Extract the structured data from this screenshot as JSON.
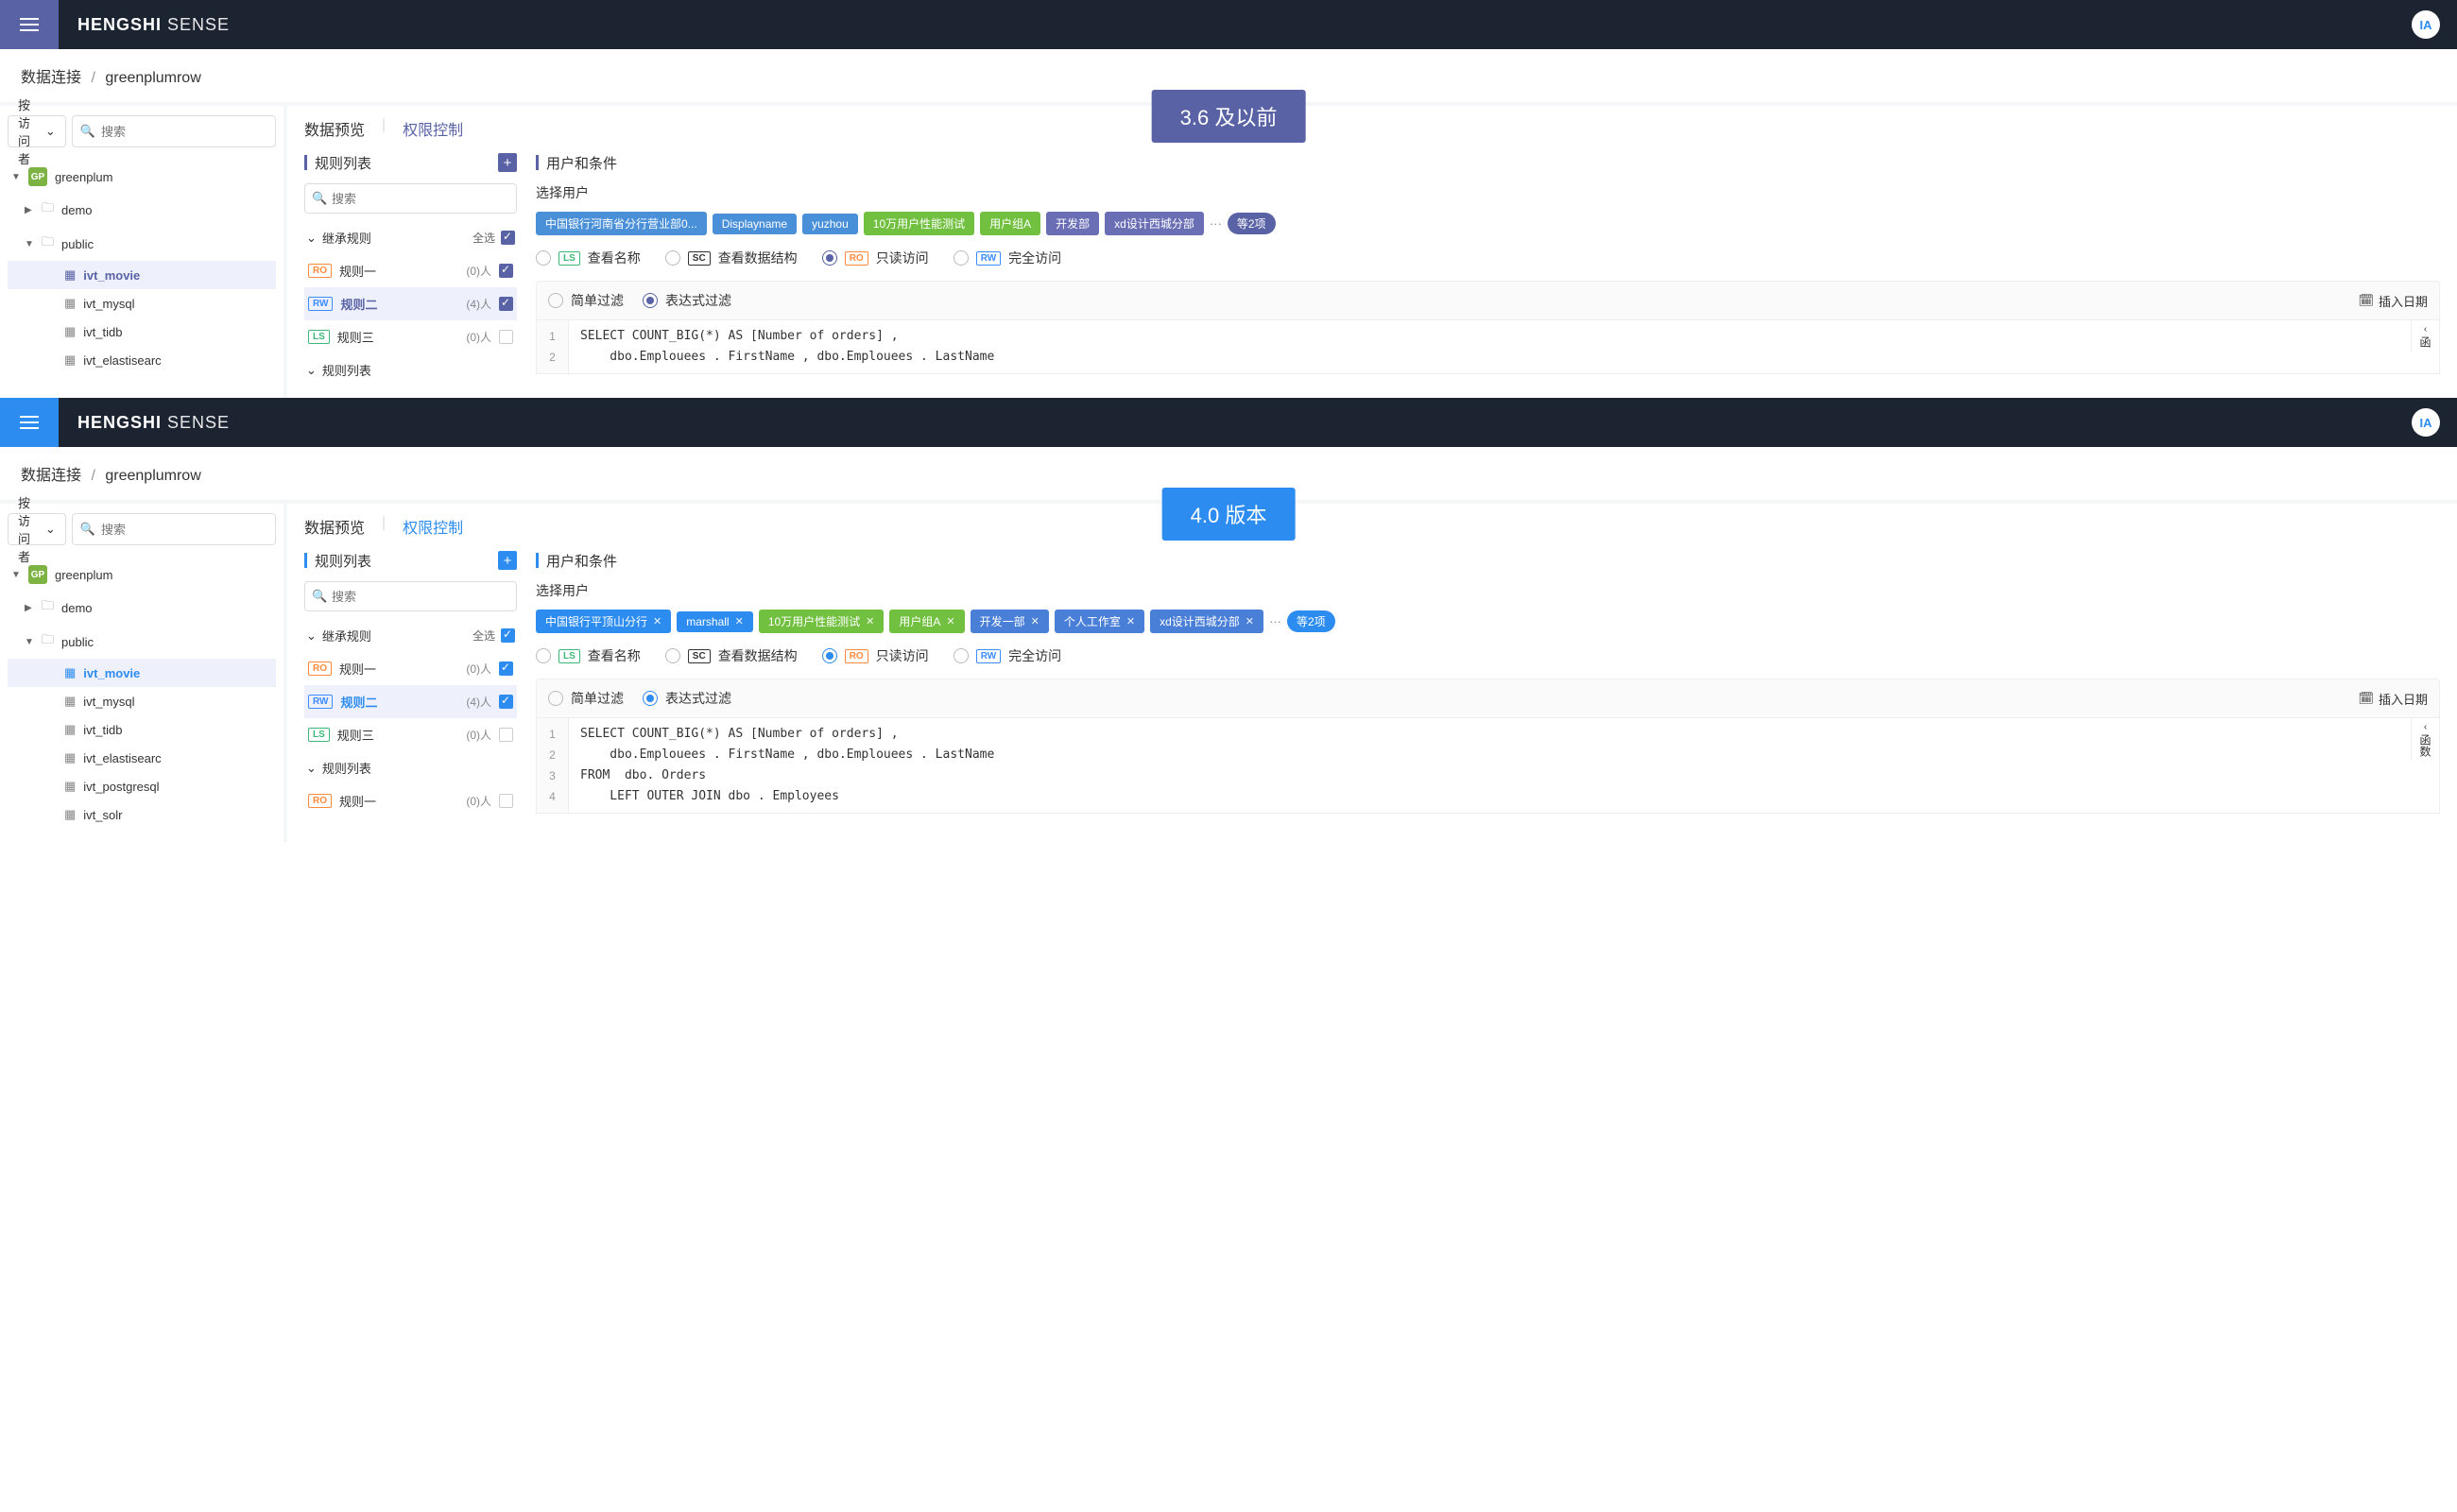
{
  "brand": {
    "bold": "HENGSHI",
    "light": "SENSE",
    "avatar": "IA"
  },
  "badges": {
    "v36": "3.6 及以前",
    "v40": "4.0 版本"
  },
  "breadcrumb": {
    "a": "数据连接",
    "b": "greenplumrow"
  },
  "sidebar": {
    "visitor_label": "按访问者",
    "search_ph": "搜索",
    "root": {
      "label": "greenplum",
      "badge": "GP"
    },
    "folders": [
      {
        "label": "demo",
        "expanded": false
      },
      {
        "label": "public",
        "expanded": true
      }
    ],
    "tables_v36": [
      "ivt_movie",
      "ivt_mysql",
      "ivt_tidb",
      "ivt_elastisearc"
    ],
    "tables_v40": [
      "ivt_movie",
      "ivt_mysql",
      "ivt_tidb",
      "ivt_elastisearc",
      "ivt_postgresql",
      "ivt_solr"
    ],
    "selected": "ivt_movie"
  },
  "tabs": {
    "preview": "数据预览",
    "perm": "权限控制"
  },
  "rules": {
    "title": "规则列表",
    "search_ph": "搜索",
    "group1_label": "继承规则",
    "select_all": "全选",
    "group2_label": "规则列表",
    "items": [
      {
        "perm": "RO",
        "name": "规则一",
        "count": "(0)人",
        "checked": true,
        "active": false
      },
      {
        "perm": "RW",
        "name": "规则二",
        "count": "(4)人",
        "checked": true,
        "active": true
      },
      {
        "perm": "LS",
        "name": "规则三",
        "count": "(0)人",
        "checked": false,
        "active": false
      }
    ],
    "extra_v40": {
      "perm": "RO",
      "name": "规则一",
      "count": "(0)人"
    }
  },
  "users": {
    "title": "用户和条件",
    "select_label": "选择用户",
    "chips_v36": [
      {
        "text": "中国银行河南省分行营业部0...",
        "cls": "chip-blue"
      },
      {
        "text": "Displayname",
        "cls": "chip-blue"
      },
      {
        "text": "yuzhou",
        "cls": "chip-blue"
      },
      {
        "text": "10万用户性能测试",
        "cls": "chip-green"
      },
      {
        "text": "用户组A",
        "cls": "chip-green"
      },
      {
        "text": "开发部",
        "cls": "chip-purple"
      },
      {
        "text": "xd设计西城分部",
        "cls": "chip-purple"
      }
    ],
    "chips_v40": [
      {
        "text": "中国银行平顶山分行",
        "cls": "chip-bright",
        "x": true
      },
      {
        "text": "marshall",
        "cls": "chip-bright",
        "x": true
      },
      {
        "text": "10万用户性能测试",
        "cls": "chip-green",
        "x": true
      },
      {
        "text": "用户组A",
        "cls": "chip-green",
        "x": true
      },
      {
        "text": "开发一部",
        "cls": "chip-purple",
        "x": true
      },
      {
        "text": "个人工作室",
        "cls": "chip-purple",
        "x": true
      },
      {
        "text": "xd设计西城分部",
        "cls": "chip-purple",
        "x": true
      }
    ],
    "more_label": "等2项",
    "access": [
      {
        "tag": "LS",
        "label": "查看名称"
      },
      {
        "tag": "SC",
        "label": "查看数据结构"
      },
      {
        "tag": "RO",
        "label": "只读访问"
      },
      {
        "tag": "RW",
        "label": "完全访问"
      }
    ],
    "access_selected": 2,
    "filter": {
      "simple": "简单过滤",
      "expr": "表达式过滤",
      "selected": "expr",
      "insert_date": "插入日期"
    },
    "sql_v36": [
      "SELECT COUNT_BIG(*) AS [Number of orders] ,",
      "    dbo.Emplouees . FirstName , dbo.Emplouees . LastName"
    ],
    "sql_v40": [
      "SELECT COUNT_BIG(*) AS [Number of orders] ,",
      "    dbo.Emplouees . FirstName , dbo.Emplouees . LastName",
      "FROM  dbo. Orders",
      "    LEFT OUTER JOIN dbo . Employees"
    ],
    "fn_label_v36": "函",
    "fn_label_v40": "函数"
  }
}
